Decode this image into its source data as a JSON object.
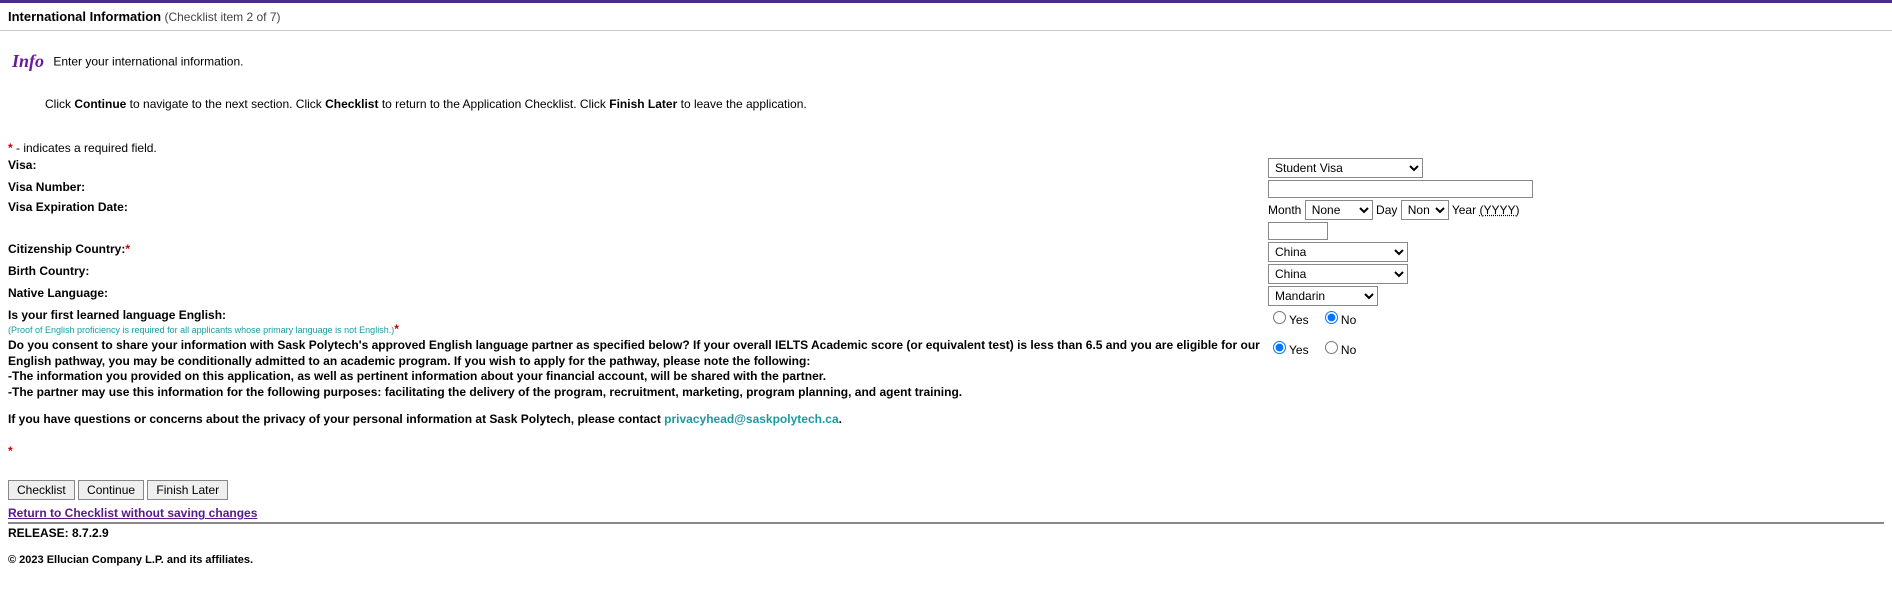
{
  "header": {
    "title": "International Information",
    "subtitle": "(Checklist item 2 of 7)"
  },
  "info_icon": "Info",
  "info_text": "Enter your international information.",
  "instructions": {
    "pre1": "Click ",
    "b1": "Continue",
    "mid1": " to navigate to the next section. Click ",
    "b2": "Checklist",
    "mid2": " to return to the Application Checklist. Click ",
    "b3": "Finish Later",
    "post": " to leave the application."
  },
  "required_note": " - indicates a required field.",
  "labels": {
    "visa": "Visa:",
    "visa_number": "Visa Number:",
    "visa_exp": "Visa Expiration Date:",
    "month": "Month",
    "day": "Day",
    "year": "Year",
    "year_fmt": "(YYYY)",
    "citizenship": "Citizenship Country:",
    "birth": "Birth Country:",
    "native_lang": "Native Language:",
    "first_lang": "Is your first learned language English:",
    "proof_note": "(Proof of English proficiency is required for all applicants whose primary language is not English.)",
    "yes": "Yes",
    "no": "No"
  },
  "consent": {
    "line1": "Do you consent to share your information with Sask Polytech's approved English language partner as specified below? If your overall IELTS Academic score (or equivalent test) is less than 6.5 and you are eligible for our English pathway, you may be conditionally admitted to an academic program. If you wish to apply for the pathway, please note the following:",
    "bullet1": "-The information you provided on this application, as well as pertinent information about your financial account, will be shared with the partner.",
    "bullet2": "-The partner may use this information for the following purposes: facilitating the delivery of the program, recruitment, marketing, program planning, and agent training.",
    "contact_pre": "If you have questions or concerns about the privacy of your personal information at Sask Polytech, please contact ",
    "email": "privacyhead@saskpolytech.ca",
    "contact_post": "."
  },
  "values": {
    "visa_selected": "Student Visa",
    "visa_number": "",
    "month_selected": "None",
    "day_selected": "None",
    "year": "",
    "citizenship_selected": "China",
    "birth_selected": "China",
    "lang_selected": "Mandarin"
  },
  "buttons": {
    "checklist": "Checklist",
    "continue": "Continue",
    "finish_later": "Finish Later"
  },
  "return_link": "Return to Checklist without saving changes",
  "release": "RELEASE: 8.7.2.9",
  "copyright": "© 2023 Ellucian Company L.P. and its affiliates."
}
